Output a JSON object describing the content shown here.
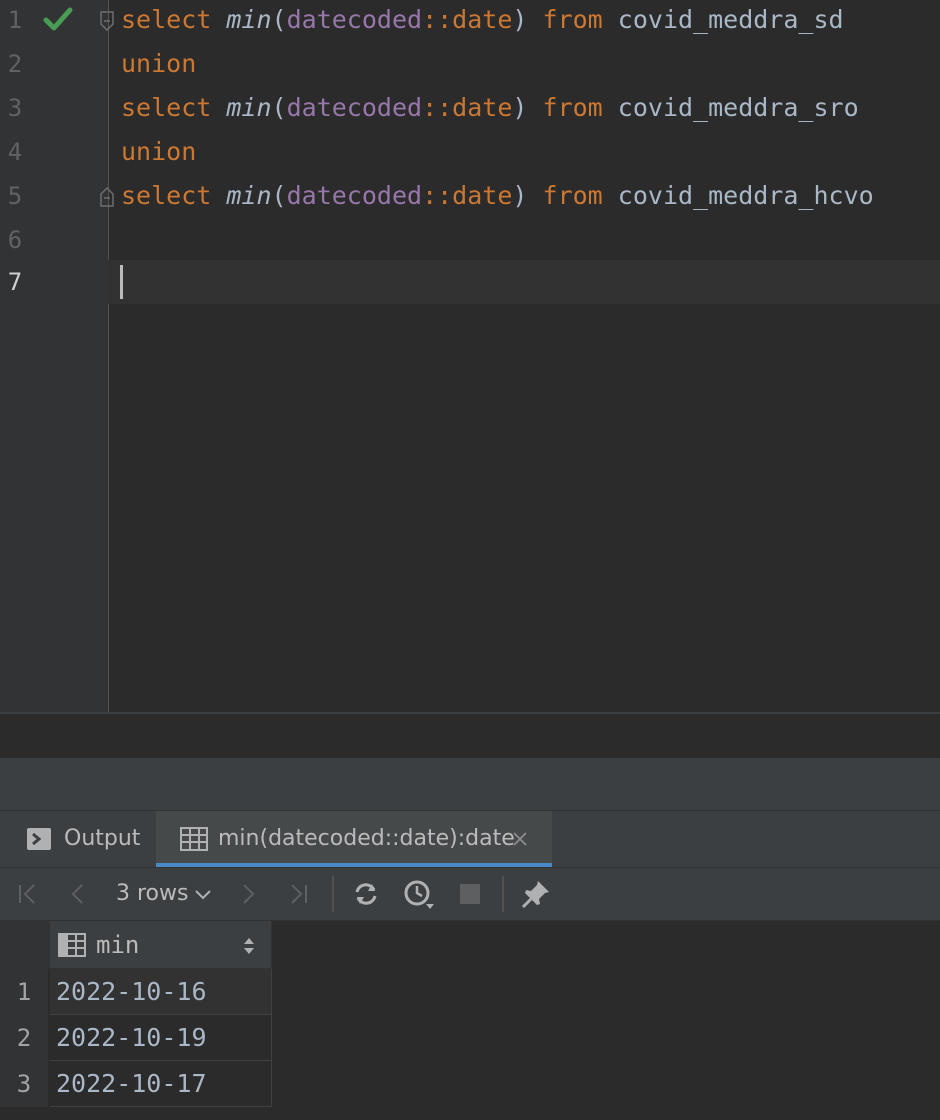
{
  "editor": {
    "lines": [
      {
        "num": "1",
        "kw1": "select",
        "fn": "min",
        "open": "(",
        "col": "datecoded",
        "cast": "::",
        "type": "date",
        "close": ")",
        "kw2": "from",
        "table": "covid_meddra_sd"
      },
      {
        "num": "2",
        "kw": "union"
      },
      {
        "num": "3",
        "kw1": "select",
        "fn": "min",
        "open": "(",
        "col": "datecoded",
        "cast": "::",
        "type": "date",
        "close": ")",
        "kw2": "from",
        "table": "covid_meddra_sro"
      },
      {
        "num": "4",
        "kw": "union"
      },
      {
        "num": "5",
        "kw1": "select",
        "fn": "min",
        "open": "(",
        "col": "datecoded",
        "cast": "::",
        "type": "date",
        "close": ")",
        "kw2": "from",
        "table": "covid_meddra_hcvo"
      },
      {
        "num": "6"
      },
      {
        "num": "7"
      }
    ]
  },
  "tabs": {
    "output_label": "Output",
    "result_label": "min(datecoded::date):date"
  },
  "toolbar": {
    "rows_label": "3 rows"
  },
  "grid": {
    "column": "min",
    "rows": [
      {
        "num": "1",
        "value": "2022-10-16"
      },
      {
        "num": "2",
        "value": "2022-10-19"
      },
      {
        "num": "3",
        "value": "2022-10-17"
      }
    ]
  },
  "colors": {
    "keyword": "#cc7832",
    "column": "#9876aa",
    "text": "#a9b7c6",
    "check": "#499c54",
    "accent": "#4a88c7"
  }
}
